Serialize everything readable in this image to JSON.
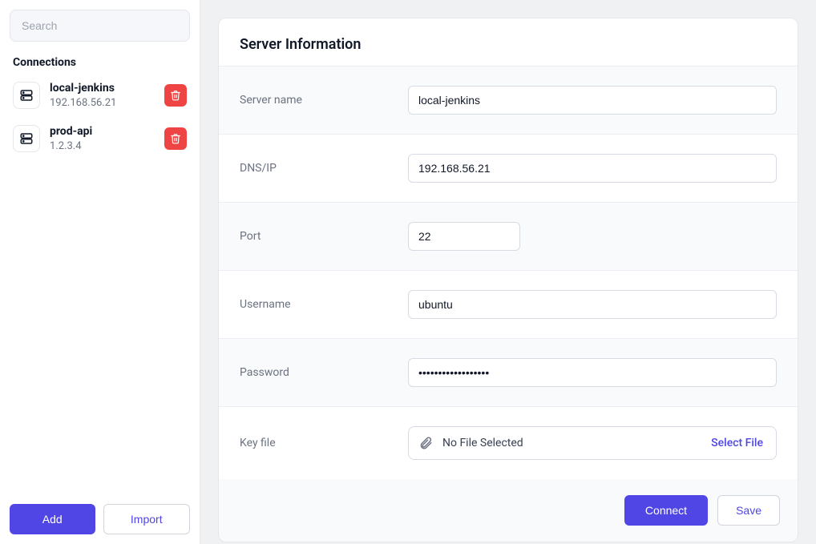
{
  "sidebar": {
    "search_placeholder": "Search",
    "section_title": "Connections",
    "connections": [
      {
        "name": "local-jenkins",
        "host": "192.168.56.21"
      },
      {
        "name": "prod-api",
        "host": "1.2.3.4"
      }
    ],
    "add_label": "Add",
    "import_label": "Import"
  },
  "panel": {
    "title": "Server Information",
    "labels": {
      "server_name": "Server name",
      "host": "DNS/IP",
      "port": "Port",
      "username": "Username",
      "password": "Password",
      "keyfile": "Key file"
    },
    "values": {
      "server_name": "local-jenkins",
      "host": "192.168.56.21",
      "port": "22",
      "username": "ubuntu",
      "password": "••••••••••••••••••",
      "keyfile_text": "No File Selected",
      "select_file": "Select File"
    },
    "connect_label": "Connect",
    "save_label": "Save"
  }
}
